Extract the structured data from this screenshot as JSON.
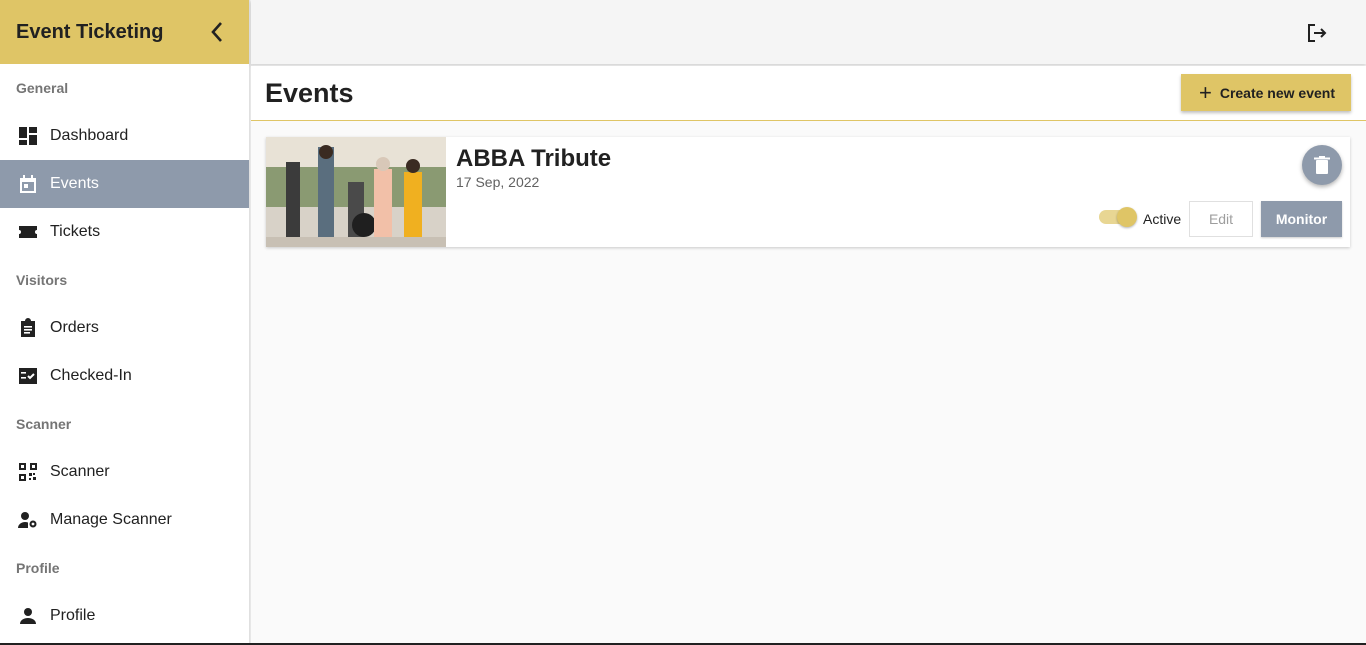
{
  "sidebar": {
    "title": "Event Ticketing",
    "sections": [
      {
        "title": "General",
        "items": [
          {
            "label": "Dashboard",
            "icon": "dashboard-icon"
          },
          {
            "label": "Events",
            "icon": "calendar-icon",
            "active": true
          },
          {
            "label": "Tickets",
            "icon": "ticket-icon"
          }
        ]
      },
      {
        "title": "Visitors",
        "items": [
          {
            "label": "Orders",
            "icon": "clipboard-icon"
          },
          {
            "label": "Checked-In",
            "icon": "checklist-icon"
          }
        ]
      },
      {
        "title": "Scanner",
        "items": [
          {
            "label": "Scanner",
            "icon": "qr-code-icon"
          },
          {
            "label": "Manage Scanner",
            "icon": "user-settings-icon"
          }
        ]
      },
      {
        "title": "Profile",
        "items": [
          {
            "label": "Profile",
            "icon": "person-icon"
          }
        ]
      }
    ]
  },
  "main": {
    "title": "Events",
    "create_label": "Create new event"
  },
  "events": [
    {
      "name": "ABBA Tribute",
      "date": "17 Sep, 2022",
      "status_label": "Active",
      "active": true,
      "edit_label": "Edit",
      "monitor_label": "Monitor"
    }
  ],
  "colors": {
    "accent": "#dfc566",
    "nav_active": "#8e9aab",
    "monitor": "#8e9aab"
  }
}
